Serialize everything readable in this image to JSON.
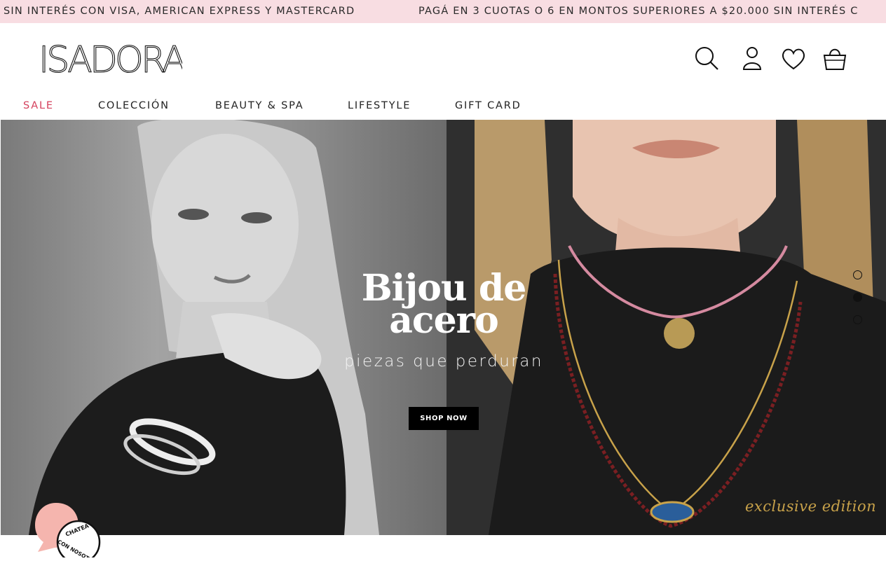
{
  "promo": {
    "text_1": "SIN INTERÉS CON VISA, AMERICAN EXPRESS Y MASTERCARD",
    "text_2": "PAGÁ EN 3 CUOTAS O 6 EN MONTOS SUPERIORES A $20.000 SIN INTERÉS C"
  },
  "brand": {
    "logo_text": "ISADORA"
  },
  "header_icons": [
    "search-icon",
    "account-icon",
    "wishlist-heart-icon",
    "shopping-bag-icon"
  ],
  "nav": {
    "items": [
      {
        "label": "SALE",
        "highlight": true
      },
      {
        "label": "COLECCIÓN"
      },
      {
        "label": "BEAUTY & SPA"
      },
      {
        "label": "LIFESTYLE"
      },
      {
        "label": "GIFT CARD"
      }
    ]
  },
  "hero": {
    "title_line1": "Bijou de",
    "title_line2": "acero",
    "subtitle": "piezas que perduran",
    "cta_label": "SHOP NOW",
    "badge": "exclusive edition"
  },
  "carousel": {
    "slides": 3,
    "active_index": 1
  },
  "chat": {
    "label_top": "CHATEA",
    "label_bottom": "CON NOSOTROS"
  },
  "colors": {
    "promo_bg": "#f8dde2",
    "sale_accent": "#d4405c",
    "cta_bg": "#000000",
    "gold": "#c8a24a",
    "chat_pink": "#f5b5ae"
  }
}
